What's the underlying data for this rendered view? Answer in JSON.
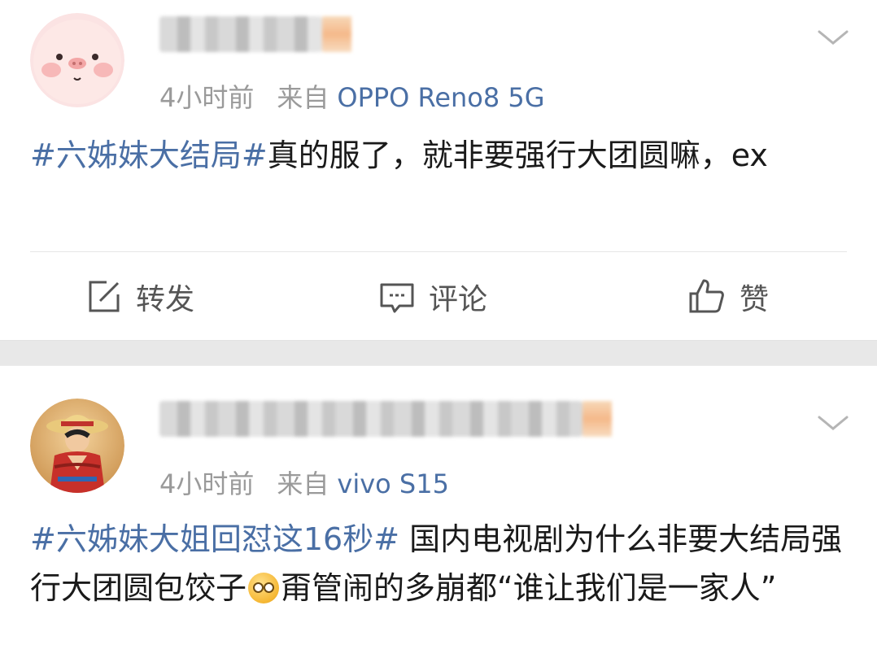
{
  "posts": [
    {
      "time": "4小时前",
      "source_label": "来自",
      "device": "OPPO Reno8 5G",
      "hashtag": "#六姊妹大结局#",
      "text": "真的服了，就非要强行大团圆嘛，ex"
    },
    {
      "time": "4小时前",
      "source_label": "来自",
      "device": "vivo S15",
      "hashtag": "#六姊妹大姐回怼这16秒#",
      "text_before_emoji": " 国内电视剧为什么非要大结局强行大团圆包饺子",
      "text_after_emoji": "甭管闹的多崩都“谁让我们是一家人”"
    }
  ],
  "actions": {
    "repost": "转发",
    "comment": "评论",
    "like": "赞"
  },
  "icons": {
    "avatar_1": "pig-avatar-icon",
    "avatar_2": "straw-hat-character-avatar-icon",
    "menu": "chevron-down-icon",
    "repost": "repost-icon",
    "comment": "comment-icon",
    "like": "thumbs-up-icon",
    "emoji": "blushing-face-emoji-icon"
  },
  "colors": {
    "link": "#4a6fa5",
    "meta": "#9a9a9a",
    "text": "#1a1a1a",
    "separator": "#e8e8e8"
  }
}
